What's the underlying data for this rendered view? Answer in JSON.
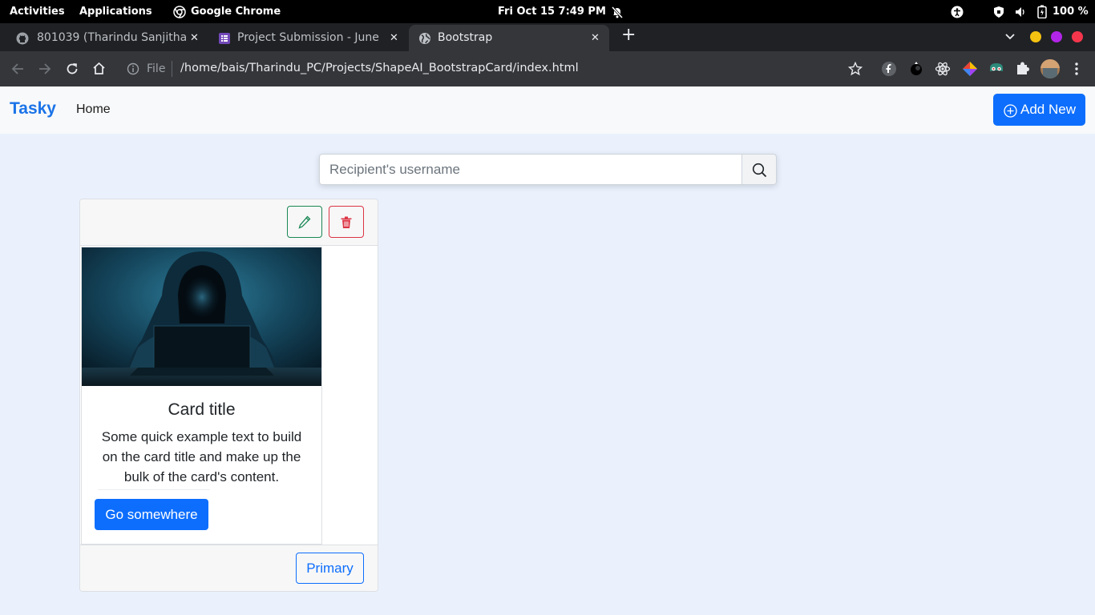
{
  "system_bar": {
    "activities": "Activities",
    "applications": "Applications",
    "app_name": "Google Chrome",
    "datetime": "Fri Oct 15   7:49 PM",
    "battery": "100 %"
  },
  "browser": {
    "tabs": [
      {
        "title": "801039 (Tharindu Sanjitha",
        "icon": "github-icon"
      },
      {
        "title": "Project Submission - June",
        "icon": "forms-icon"
      },
      {
        "title": "Bootstrap",
        "icon": "globe-icon",
        "active": true
      }
    ],
    "close_glyph": "✕",
    "new_tab_glyph": "+",
    "address": {
      "scheme_label": "File",
      "url": "/home/bais/Tharindu_PC/Projects/ShapeAI_BootstrapCard/index.html"
    }
  },
  "navbar": {
    "brand": "Tasky",
    "home": "Home",
    "add_button": "Add New"
  },
  "search": {
    "placeholder": "Recipient's username"
  },
  "card": {
    "title": "Card title",
    "text": "Some quick example text to build on the card title and make up the bulk of the card's content.",
    "button": "Go somewhere",
    "footer_button": "Primary"
  },
  "colors": {
    "brand": "#1a73e8",
    "primary": "#0d6efd",
    "success": "#198754",
    "danger": "#dc3545",
    "page_bg": "#eaf1fd"
  }
}
